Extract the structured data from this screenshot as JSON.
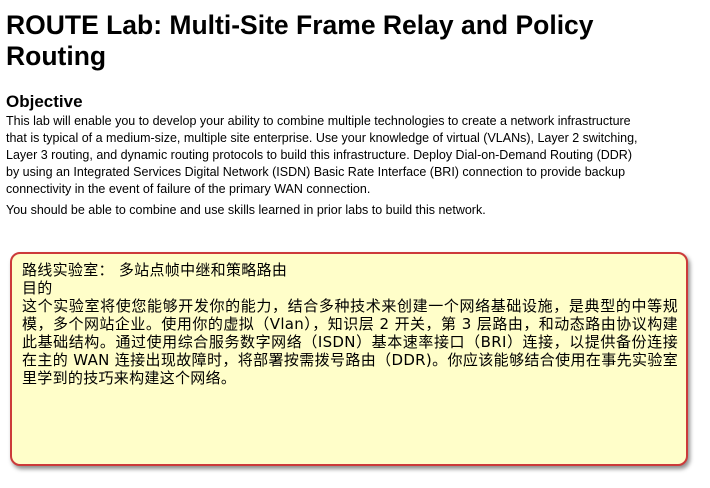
{
  "document": {
    "title": "ROUTE Lab: Multi-Site Frame Relay and Policy Routing",
    "objective_heading": "Objective",
    "objective_paragraph": "This lab will enable you to develop your ability to combine multiple technologies to create a network infrastructure that is typical of a medium-size, multiple site enterprise. Use your knowledge of virtual (VLANs), Layer 2 switching, Layer 3 routing, and dynamic routing protocols to build this infrastructure. Deploy Dial-on-Demand Routing (DDR) by using an Integrated Services Digital Network (ISDN) Basic Rate Interface (BRI) connection to provide backup connectivity in the event of failure of the primary WAN connection.",
    "prior_labs_paragraph": "You should be able to combine and use skills learned in prior labs to build this network."
  },
  "translation_box": {
    "title": "路线实验室： 多站点帧中继和策略路由",
    "heading": "目的",
    "body": "这个实验室将使您能够开发你的能力，结合多种技术来创建一个网络基础设施，是典型的中等规模，多个网站企业。使用你的虚拟（Vlan），知识层 2 开关，第 3 层路由，和动态路由协议构建此基础结构。通过使用综合服务数字网络（ISDN）基本速率接口（BRI）连接，以提供备份连接在主的 WAN 连接出现故障时，将部署按需拨号路由（DDR)。你应该能够结合使用在事先实验室里学到的技巧来构建这个网络。",
    "background_color": "#fffec9",
    "border_color": "#cc3a3a"
  }
}
